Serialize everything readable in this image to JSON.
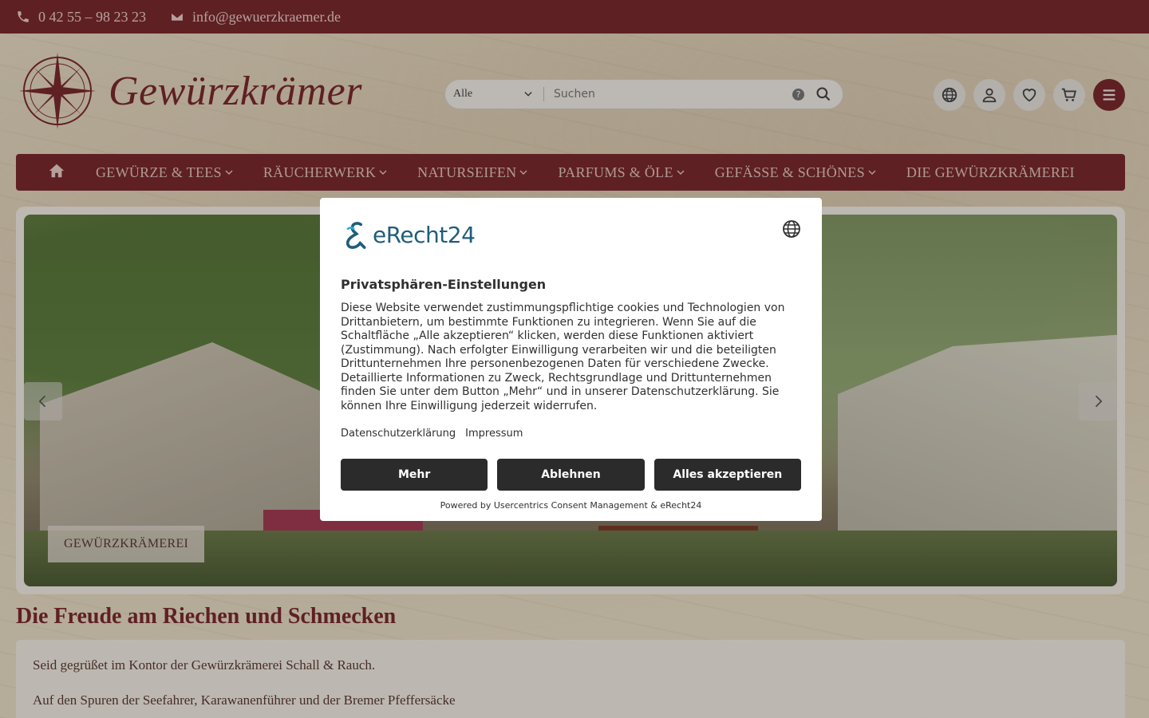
{
  "topbar": {
    "phone": "0 42 55 – 98 23 23",
    "email": "info@gewuerzkraemer.de"
  },
  "header": {
    "brand": "Gewürzkrämer",
    "search_category": "Alle",
    "search_placeholder": "Suchen",
    "help_symbol": "?",
    "icons": [
      "globe-icon",
      "user-icon",
      "heart-icon",
      "cart-icon",
      "menu-icon"
    ]
  },
  "nav": {
    "items": [
      {
        "label": "GEWÜRZE & TEES",
        "has_dropdown": true
      },
      {
        "label": "RÄUCHERWERK",
        "has_dropdown": true
      },
      {
        "label": "NATURSEIFEN",
        "has_dropdown": true
      },
      {
        "label": "PARFUMS & ÖLE",
        "has_dropdown": true
      },
      {
        "label": "GEFÄSSE & SCHÖNES",
        "has_dropdown": true
      },
      {
        "label": "DIE GEWÜRZKRÄMEREI",
        "has_dropdown": false
      }
    ]
  },
  "slider": {
    "caption": "GEWÜRZKRÄMEREI"
  },
  "intro": {
    "title": "Die Freude am Riechen und Schmecken",
    "p1": "Seid gegrüßet im Kontor der Gewürzkrämerei Schall & Rauch.",
    "p2": "Auf den Spuren der Seefahrer, Karawanenführer und der Bremer Pfeffersäcke"
  },
  "consent": {
    "logo_text": "eRecht24",
    "title": "Privatsphären-Einstellungen",
    "body": "Diese Website verwendet zustimmungspflichtige cookies und Technologien von Drittanbietern, um bestimmte Funktionen zu integrieren. Wenn Sie auf die Schaltfläche „Alle akzeptieren“ klicken, werden diese Funktionen aktiviert (Zustimmung). Nach erfolgter Einwilligung verarbeiten wir und die beteiligten Drittunternehmen Ihre personenbezogenen Daten für verschiedene Zwecke. Detaillierte Informationen zu Zweck, Rechtsgrundlage und Drittunternehmen finden Sie unter dem Button „Mehr“ und in unserer Datenschutzerklärung. Sie können Ihre Einwilligung jederzeit widerrufen.",
    "link_privacy": "Datenschutzerklärung",
    "link_imprint": "Impressum",
    "btn_more": "Mehr",
    "btn_decline": "Ablehnen",
    "btn_accept": "Alles akzeptieren",
    "powered": "Powered by Usercentrics Consent Management & eRecht24"
  },
  "colors": {
    "brand": "#7a2a2e",
    "button_dark": "#2b2b2b",
    "erecht_blue": "#1f5d7a"
  }
}
